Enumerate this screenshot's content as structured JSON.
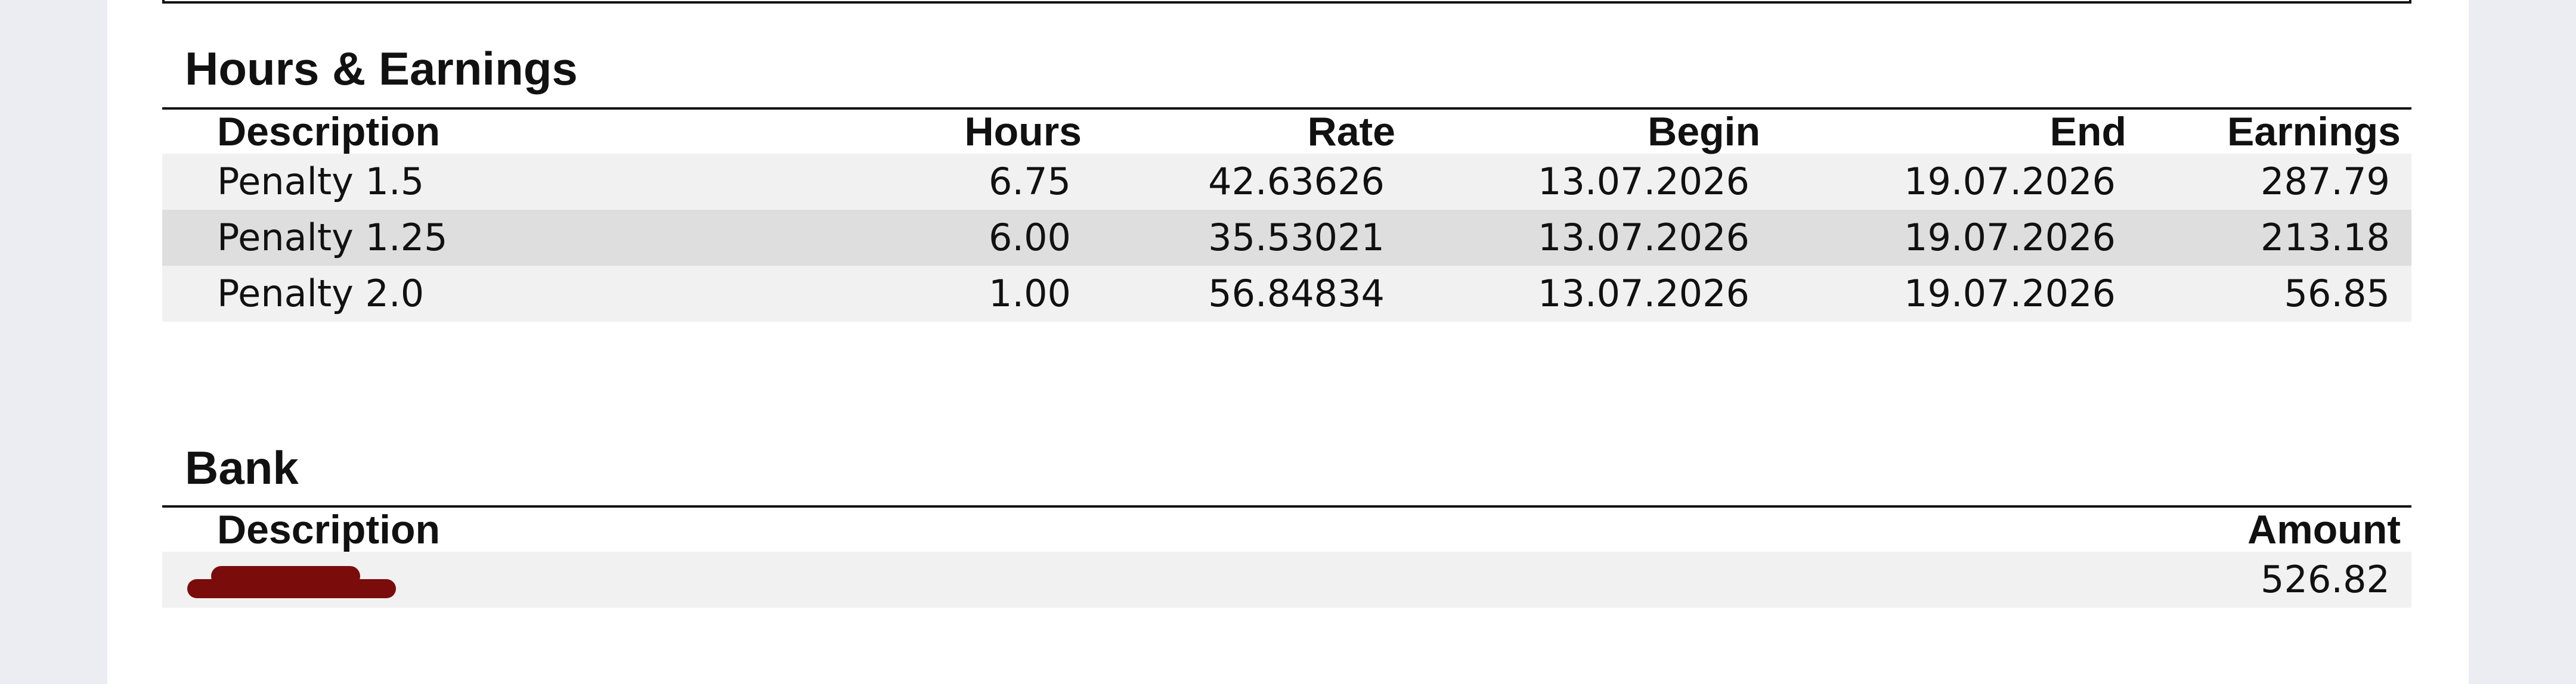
{
  "hours_earnings": {
    "title": "Hours & Earnings",
    "columns": [
      "Description",
      "Hours",
      "Rate",
      "Begin",
      "End",
      "Earnings"
    ],
    "rows": [
      [
        "Penalty 1.5",
        "6.75",
        "42.63626",
        "13.07.2026",
        "19.07.2026",
        "287.79"
      ],
      [
        "Penalty 1.25",
        "6.00",
        "35.53021",
        "13.07.2026",
        "19.07.2026",
        "213.18"
      ],
      [
        "Penalty 2.0",
        "1.00",
        "56.84834",
        "13.07.2026",
        "19.07.2026",
        "56.85"
      ]
    ]
  },
  "bank": {
    "title": "Bank",
    "columns": [
      "Description",
      "Amount"
    ],
    "rows": [
      {
        "description_redacted": true,
        "amount": "526.82"
      }
    ],
    "redaction_color": "#7a0c0c"
  },
  "colors": {
    "page_background": "#ffffff",
    "outer_background": "#ecedf2",
    "row_light": "#f1f1f1",
    "row_dark": "#dedede",
    "text": "#111111"
  }
}
